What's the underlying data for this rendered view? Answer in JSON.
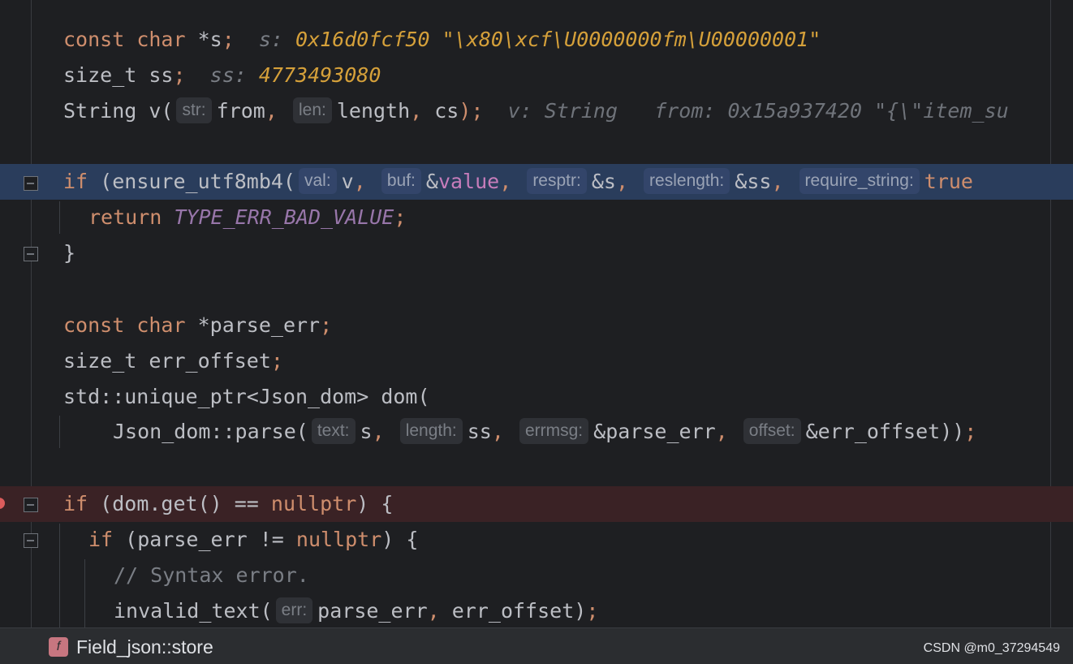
{
  "lines": {
    "l1": {
      "kw1": "const",
      "kw2": "char",
      "rest": " *s",
      "semi": ";",
      "dbg_name": "s:",
      "dbg_val": "0x16d0fcf50 \"\\x80\\xcf\\U0000000fm\\U00000001\""
    },
    "l2": {
      "ty": "size_t ss",
      "semi": ";",
      "dbg_name": "ss:",
      "dbg_val": "4773493080"
    },
    "l3": {
      "pre": "String v(",
      "h1": "str:",
      "a1": "from",
      "c1": ", ",
      "h2": "len:",
      "a2": "length",
      "c2": ", ",
      "a3": "cs",
      "post": ");",
      "dbg1": "v: String",
      "dbg2": "from: 0x15a937420 \"{\\\"item_su"
    },
    "l4": {
      "kw": "if",
      "pre": " (ensure_utf8mb4(",
      "h1": "val:",
      "a1": "v",
      "c1": ", ",
      "h2": "buf:",
      "a2a": "&",
      "a2b": "value",
      "c2": ", ",
      "h3": "resptr:",
      "a3": "&s",
      "c3": ", ",
      "h4": "reslength:",
      "a4": "&ss",
      "c4": ", ",
      "h5": "require_string:",
      "a5": "true"
    },
    "l5": {
      "kw": "return",
      "val": "TYPE_ERR_BAD_VALUE",
      "semi": ";"
    },
    "l6": {
      "text": "}"
    },
    "l7": {
      "kw1": "const",
      "kw2": "char",
      "rest": " *parse_err",
      "semi": ";"
    },
    "l8": {
      "ty": "size_t err_offset",
      "semi": ";"
    },
    "l9": {
      "text": "std::unique_ptr<Json_dom> dom("
    },
    "l10": {
      "pre": "Json_dom::parse(",
      "h1": "text:",
      "a1": "s",
      "c1": ", ",
      "h2": "length:",
      "a2": "ss",
      "c2": ", ",
      "h3": "errmsg:",
      "a3": "&parse_err",
      "c3": ", ",
      "h4": "offset:",
      "a4": "&err_offset",
      "post": "))",
      "semi": ";"
    },
    "l11": {
      "kw": "if",
      "pre": " (dom.get() == ",
      "null": "nullptr",
      "post": ") {"
    },
    "l12": {
      "kw": "if",
      "pre": " (parse_err != ",
      "null": "nullptr",
      "post": ") {"
    },
    "l13": {
      "text": "// Syntax error."
    },
    "l14": {
      "pre": "invalid_text(",
      "h1": "err:",
      "a1": "parse_err",
      "c1": ", ",
      "a2": "err_offset",
      "post": ")",
      "semi": ";"
    }
  },
  "status": {
    "badge": "f",
    "breadcrumb": "Field_json::store",
    "watermark": "CSDN @m0_37294549"
  },
  "colors": {
    "keyword": "#cf8e6d",
    "debug_value": "#d5a03a",
    "macro": "#9876aa",
    "highlight_blue": "#2a3d5c",
    "highlight_red": "#3a2225"
  }
}
